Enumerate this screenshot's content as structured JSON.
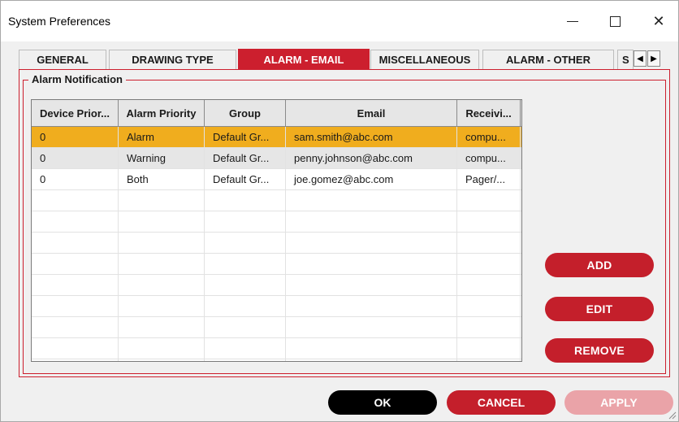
{
  "window": {
    "title": "System Preferences",
    "minimize_glyph": "—",
    "close_glyph": "✕"
  },
  "tabs": [
    {
      "label": "GENERAL",
      "active": false
    },
    {
      "label": "DRAWING TYPE",
      "active": false
    },
    {
      "label": "ALARM - EMAIL",
      "active": true
    },
    {
      "label": "MISCELLANEOUS",
      "active": false
    },
    {
      "label": "ALARM - OTHER",
      "active": false
    },
    {
      "label": "S",
      "active": false
    }
  ],
  "tab_scroll": {
    "left_icon": "◀",
    "right_icon": "▶"
  },
  "group": {
    "label": "Alarm Notification"
  },
  "table": {
    "columns": [
      "Device Prior...",
      "Alarm Priority",
      "Group",
      "Email",
      "Receivi..."
    ],
    "rows": [
      {
        "device_priority": "0",
        "alarm_priority": "Alarm",
        "group": "Default Gr...",
        "email": "sam.smith@abc.com",
        "receiving": "compu...",
        "state": "selected"
      },
      {
        "device_priority": "0",
        "alarm_priority": "Warning",
        "group": "Default Gr...",
        "email": "penny.johnson@abc.com",
        "receiving": "compu...",
        "state": "alt"
      },
      {
        "device_priority": "0",
        "alarm_priority": "Both",
        "group": "Default Gr...",
        "email": "joe.gomez@abc.com",
        "receiving": "Pager/...",
        "state": "normal"
      }
    ]
  },
  "side_buttons": {
    "add": "ADD",
    "edit": "EDIT",
    "remove": "REMOVE"
  },
  "bottom_buttons": {
    "ok": "OK",
    "cancel": "CANCEL",
    "apply": "APPLY"
  },
  "colors": {
    "accent_red": "#c41f2b",
    "selected_row": "#f0ad1e",
    "apply_disabled": "#eaa3a8",
    "ok_black": "#000000"
  }
}
